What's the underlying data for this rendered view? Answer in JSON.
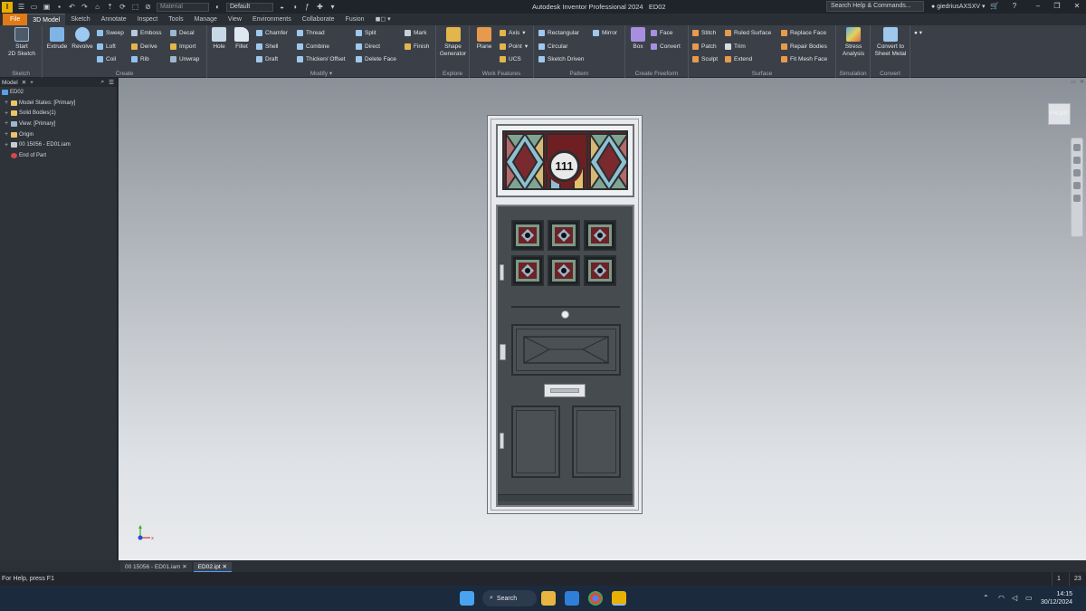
{
  "app": {
    "title": "Autodesk Inventor Professional 2024",
    "document": "ED02",
    "logo_letter": "I",
    "material_placeholder": "Material",
    "appearance": "Default",
    "search_placeholder": "Search Help & Commands...",
    "user": "giedriusAXSXV"
  },
  "tabs": [
    "File",
    "3D Model",
    "Sketch",
    "Annotate",
    "Inspect",
    "Tools",
    "Manage",
    "View",
    "Environments",
    "Collaborate",
    "Fusion"
  ],
  "active_tab": "3D Model",
  "ribbon": {
    "sketch": {
      "title": "Sketch",
      "start": "Start",
      "start2": "2D Sketch"
    },
    "create": {
      "title": "Create",
      "extrude": "Extrude",
      "revolve": "Revolve",
      "sweep": "Sweep",
      "loft": "Loft",
      "coil": "Coil",
      "emboss": "Emboss",
      "derive": "Derive",
      "rib": "Rib",
      "decal": "Decal",
      "import": "Import",
      "unwrap": "Unwrap"
    },
    "modify": {
      "title": "Modify",
      "hole": "Hole",
      "fillet": "Fillet",
      "chamfer": "Chamfer",
      "shell": "Shell",
      "draft": "Draft",
      "thread": "Thread",
      "combine": "Combine",
      "thicken": "Thicken/ Offset",
      "split": "Split",
      "direct": "Direct",
      "delete_face": "Delete Face",
      "mark": "Mark",
      "finish": "Finish"
    },
    "explore": {
      "title": "Explore",
      "shape": "Shape",
      "generator": "Generator"
    },
    "work": {
      "title": "Work Features",
      "plane": "Plane",
      "axis": "Axis",
      "point": "Point",
      "ucs": "UCS"
    },
    "pattern": {
      "title": "Pattern",
      "rectangular": "Rectangular",
      "circular": "Circular",
      "sketch_driven": "Sketch Driven",
      "mirror": "Mirror"
    },
    "freeform": {
      "title": "Create Freeform",
      "box": "Box",
      "face": "Face",
      "convert": "Convert"
    },
    "surface": {
      "title": "Surface",
      "stitch": "Stitch",
      "patch": "Patch",
      "sculpt": "Sculpt",
      "ruled": "Ruled Surface",
      "trim": "Trim",
      "extend": "Extend",
      "replace": "Replace Face",
      "repair": "Repair Bodies",
      "fit_mesh": "Fit Mesh Face"
    },
    "simulation": {
      "title": "Simulation",
      "stress": "Stress",
      "analysis": "Analysis"
    },
    "convert": {
      "title": "Convert",
      "to_sheet1": "Convert to",
      "to_sheet2": "Sheet Metal"
    }
  },
  "browser": {
    "tab": "Model",
    "items": [
      {
        "label": "ED02",
        "indent": 0
      },
      {
        "label": "Model States: [Primary]",
        "indent": 1
      },
      {
        "label": "Solid Bodies(1)",
        "indent": 1
      },
      {
        "label": "View: [Primary]",
        "indent": 1
      },
      {
        "label": "Origin",
        "indent": 1
      },
      {
        "label": "00 15056 - ED01.iam",
        "indent": 1
      },
      {
        "label": "End of Part",
        "indent": 1
      }
    ]
  },
  "viewcube_label": "FRONT",
  "door": {
    "house_number": "111"
  },
  "doc_tabs": [
    {
      "label": "00 15056 - ED01.iam",
      "active": false
    },
    {
      "label": "ED02.ipt",
      "active": true
    }
  ],
  "status": {
    "help": "For Help, press F1",
    "num1": "1",
    "num2": "23"
  },
  "taskbar": {
    "search": "Search",
    "time": "14:15",
    "date": "30/12/2024"
  }
}
